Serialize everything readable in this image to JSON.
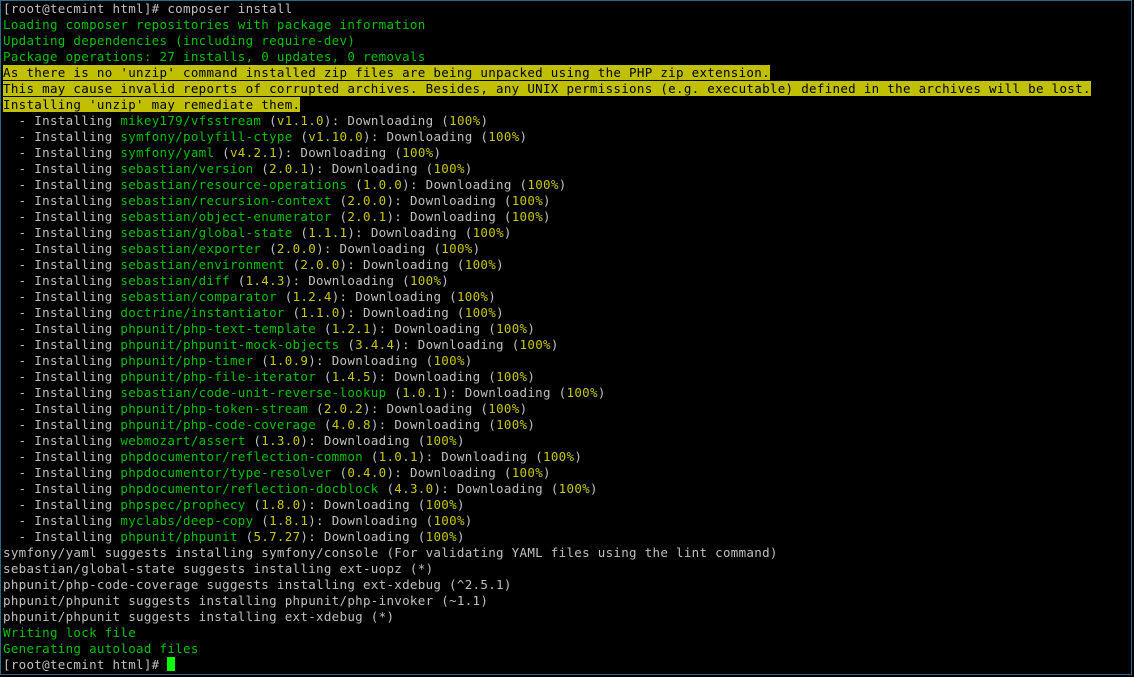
{
  "colors": {
    "background": "#000000",
    "text": "#c0c0c0",
    "info_green": "#00c000",
    "package_name_green": "#00c000",
    "version_yellow": "#c8c800",
    "warning_background": "#c0c000",
    "warning_text": "#000000",
    "cursor": "#00ff00",
    "window_border": "#2d6a8a"
  },
  "prompt": {
    "text": "[root@tecmint html]# ",
    "command": "composer install"
  },
  "messages": {
    "loading": "Loading composer repositories with package information",
    "updating": "Updating dependencies (including require-dev)",
    "operations": "Package operations: 27 installs, 0 updates, 0 removals"
  },
  "warning_lines": [
    "As there is no 'unzip' command installed zip files are being unpacked using the PHP zip extension.",
    "This may cause invalid reports of corrupted archives. Besides, any UNIX permissions (e.g. executable) defined in the archives will be lost.",
    "Installing 'unzip' may remediate them."
  ],
  "install_prefix": "  - Installing ",
  "download_label": "Downloading",
  "percent": "100%",
  "installs": [
    {
      "package": "mikey179/vfsstream",
      "version": "v1.1.0"
    },
    {
      "package": "symfony/polyfill-ctype",
      "version": "v1.10.0"
    },
    {
      "package": "symfony/yaml",
      "version": "v4.2.1"
    },
    {
      "package": "sebastian/version",
      "version": "2.0.1"
    },
    {
      "package": "sebastian/resource-operations",
      "version": "1.0.0"
    },
    {
      "package": "sebastian/recursion-context",
      "version": "2.0.0"
    },
    {
      "package": "sebastian/object-enumerator",
      "version": "2.0.1"
    },
    {
      "package": "sebastian/global-state",
      "version": "1.1.1"
    },
    {
      "package": "sebastian/exporter",
      "version": "2.0.0"
    },
    {
      "package": "sebastian/environment",
      "version": "2.0.0"
    },
    {
      "package": "sebastian/diff",
      "version": "1.4.3"
    },
    {
      "package": "sebastian/comparator",
      "version": "1.2.4"
    },
    {
      "package": "doctrine/instantiator",
      "version": "1.1.0"
    },
    {
      "package": "phpunit/php-text-template",
      "version": "1.2.1"
    },
    {
      "package": "phpunit/phpunit-mock-objects",
      "version": "3.4.4"
    },
    {
      "package": "phpunit/php-timer",
      "version": "1.0.9"
    },
    {
      "package": "phpunit/php-file-iterator",
      "version": "1.4.5"
    },
    {
      "package": "sebastian/code-unit-reverse-lookup",
      "version": "1.0.1"
    },
    {
      "package": "phpunit/php-token-stream",
      "version": "2.0.2"
    },
    {
      "package": "phpunit/php-code-coverage",
      "version": "4.0.8"
    },
    {
      "package": "webmozart/assert",
      "version": "1.3.0"
    },
    {
      "package": "phpdocumentor/reflection-common",
      "version": "1.0.1"
    },
    {
      "package": "phpdocumentor/type-resolver",
      "version": "0.4.0"
    },
    {
      "package": "phpdocumentor/reflection-docblock",
      "version": "4.3.0"
    },
    {
      "package": "phpspec/prophecy",
      "version": "1.8.0"
    },
    {
      "package": "myclabs/deep-copy",
      "version": "1.8.1"
    },
    {
      "package": "phpunit/phpunit",
      "version": "5.7.27"
    }
  ],
  "suggestions": [
    "symfony/yaml suggests installing symfony/console (For validating YAML files using the lint command)",
    "sebastian/global-state suggests installing ext-uopz (*)",
    "phpunit/php-code-coverage suggests installing ext-xdebug (^2.5.1)",
    "phpunit/phpunit suggests installing phpunit/php-invoker (~1.1)",
    "phpunit/phpunit suggests installing ext-xdebug (*)"
  ],
  "final_messages": {
    "lock": "Writing lock file",
    "autoload": "Generating autoload files"
  },
  "final_prompt": "[root@tecmint html]# "
}
